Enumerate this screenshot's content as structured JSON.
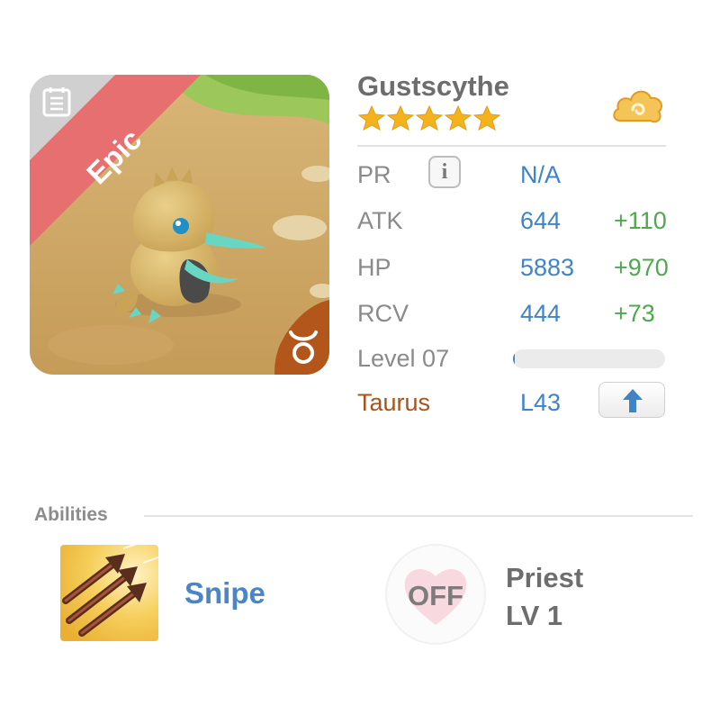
{
  "monster": {
    "name": "Gustscythe",
    "rarity": "Epic",
    "star_count": 5,
    "zodiac_icon": "taurus-icon",
    "profile_icon": "document-icon",
    "currency_icon": "cloud-coin-icon"
  },
  "stats": {
    "pr": {
      "label": "PR",
      "value": "N/A"
    },
    "atk": {
      "label": "ATK",
      "value": "644",
      "bonus": "+110"
    },
    "hp": {
      "label": "HP",
      "value": "5883",
      "bonus": "+970"
    },
    "rcv": {
      "label": "RCV",
      "value": "444",
      "bonus": "+73"
    },
    "level": {
      "label": "Level 07",
      "progress": 0.01
    },
    "zodiac": {
      "label": "Taurus",
      "value": "L43"
    }
  },
  "abilities": {
    "title": "Abilities",
    "skill_name": "Snipe",
    "leader": {
      "status": "OFF",
      "name": "Priest",
      "level": "LV 1"
    }
  },
  "colors": {
    "rarity_banner": "#e86f6f",
    "value_blue": "#3e84c6",
    "bonus_green": "#4fa84e",
    "zodiac_brown": "#a5541b",
    "zodiac_badge": "#b3561b",
    "star_gold": "#f4b21d"
  }
}
